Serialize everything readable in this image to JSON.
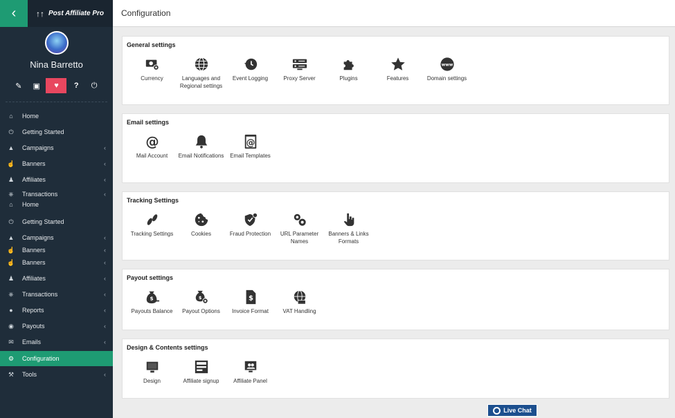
{
  "brand": {
    "name": "Post Affiliate Pro"
  },
  "user": {
    "name": "Nina Barretto"
  },
  "quick_actions": [
    {
      "icon": "pencil-icon"
    },
    {
      "icon": "monitor-icon"
    },
    {
      "icon": "heart-icon"
    },
    {
      "icon": "question-icon"
    },
    {
      "icon": "power-icon"
    }
  ],
  "nav": [
    {
      "label": "Home",
      "icon": "home-icon",
      "chev": ""
    },
    {
      "label": "Getting Started",
      "icon": "power-icon",
      "chev": ""
    },
    {
      "label": "Campaigns",
      "icon": "bullhorn-icon",
      "chev": "‹"
    },
    {
      "label": "Banners",
      "icon": "pointer-icon",
      "chev": "‹"
    },
    {
      "label": "Affiliates",
      "icon": "users-icon",
      "chev": "‹"
    },
    {
      "label": "Transactions",
      "icon": "basket-icon",
      "chev": "‹"
    },
    {
      "label": "Home",
      "icon": "home-icon",
      "chev": ""
    },
    {
      "label": "Getting Started",
      "icon": "power-icon",
      "chev": ""
    },
    {
      "label": "Campaigns",
      "icon": "bullhorn-icon",
      "chev": "‹"
    },
    {
      "label": "Banners",
      "icon": "pointer-icon",
      "chev": "‹"
    },
    {
      "label": "Banners",
      "icon": "pointer-icon",
      "chev": "‹"
    },
    {
      "label": "Affiliates",
      "icon": "users-icon",
      "chev": "‹"
    },
    {
      "label": "Transactions",
      "icon": "basket-icon",
      "chev": "‹"
    },
    {
      "label": "Reports",
      "icon": "chart-icon",
      "chev": "‹"
    },
    {
      "label": "Payouts",
      "icon": "moneybag-icon",
      "chev": "‹"
    },
    {
      "label": "Emails",
      "icon": "envelope-icon",
      "chev": "‹"
    },
    {
      "label": "Configuration",
      "icon": "gear-icon",
      "chev": ""
    },
    {
      "label": "Tools",
      "icon": "tools-icon",
      "chev": "‹"
    }
  ],
  "page": {
    "title": "Configuration"
  },
  "sections": [
    {
      "title": "General settings",
      "tiles": [
        {
          "label": "Currency",
          "icon": "currency-icon"
        },
        {
          "label": "Languages and Regional settings",
          "icon": "globe-icon"
        },
        {
          "label": "Event Logging",
          "icon": "history-icon"
        },
        {
          "label": "Proxy Server",
          "icon": "server-icon"
        },
        {
          "label": "Plugins",
          "icon": "puzzle-icon"
        },
        {
          "label": "Features",
          "icon": "star-icon"
        },
        {
          "label": "Domain settings",
          "icon": "www-icon"
        }
      ]
    },
    {
      "title": "Email settings",
      "tiles": [
        {
          "label": "Mail Account",
          "icon": "at-icon"
        },
        {
          "label": "Email Notifications",
          "icon": "bell-icon"
        },
        {
          "label": "Email Templates",
          "icon": "email-template-icon"
        }
      ]
    },
    {
      "title": "Tracking Settings",
      "tiles": [
        {
          "label": "Tracking Settings",
          "icon": "footprints-icon"
        },
        {
          "label": "Cookies",
          "icon": "cookie-icon"
        },
        {
          "label": "Fraud Protection",
          "icon": "shield-icon"
        },
        {
          "label": "URL Parameter Names",
          "icon": "gears-icon"
        },
        {
          "label": "Banners & Links Formats",
          "icon": "pointer-icon"
        }
      ]
    },
    {
      "title": "Payout settings",
      "tiles": [
        {
          "label": "Payouts Balance",
          "icon": "balance-icon"
        },
        {
          "label": "Payout Options",
          "icon": "moneybag-gear-icon"
        },
        {
          "label": "Invoice Format",
          "icon": "invoice-icon"
        },
        {
          "label": "VAT Handling",
          "icon": "vat-icon"
        }
      ]
    },
    {
      "title": "Design & Contents settings",
      "tiles": [
        {
          "label": "Design",
          "icon": "monitor-icon"
        },
        {
          "label": "Affiliate signup",
          "icon": "form-icon"
        },
        {
          "label": "Affiliate Panel",
          "icon": "panel-icon"
        }
      ]
    }
  ],
  "live_chat": {
    "label": "Live Chat"
  },
  "colors": {
    "sidebar": "#1f2d3a",
    "accent": "#1e9b73",
    "highlight": "#e8475f",
    "chat": "#1c4f8e"
  }
}
